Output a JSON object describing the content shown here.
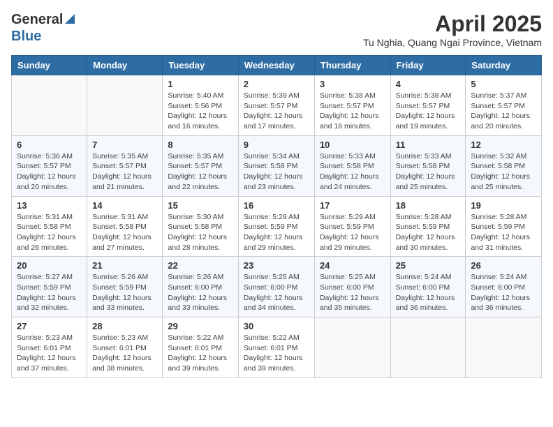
{
  "header": {
    "logo_general": "General",
    "logo_blue": "Blue",
    "month_title": "April 2025",
    "subtitle": "Tu Nghia, Quang Ngai Province, Vietnam"
  },
  "columns": [
    "Sunday",
    "Monday",
    "Tuesday",
    "Wednesday",
    "Thursday",
    "Friday",
    "Saturday"
  ],
  "weeks": [
    [
      {
        "day": "",
        "info": ""
      },
      {
        "day": "",
        "info": ""
      },
      {
        "day": "1",
        "info": "Sunrise: 5:40 AM\nSunset: 5:56 PM\nDaylight: 12 hours and 16 minutes."
      },
      {
        "day": "2",
        "info": "Sunrise: 5:39 AM\nSunset: 5:57 PM\nDaylight: 12 hours and 17 minutes."
      },
      {
        "day": "3",
        "info": "Sunrise: 5:38 AM\nSunset: 5:57 PM\nDaylight: 12 hours and 18 minutes."
      },
      {
        "day": "4",
        "info": "Sunrise: 5:38 AM\nSunset: 5:57 PM\nDaylight: 12 hours and 19 minutes."
      },
      {
        "day": "5",
        "info": "Sunrise: 5:37 AM\nSunset: 5:57 PM\nDaylight: 12 hours and 20 minutes."
      }
    ],
    [
      {
        "day": "6",
        "info": "Sunrise: 5:36 AM\nSunset: 5:57 PM\nDaylight: 12 hours and 20 minutes."
      },
      {
        "day": "7",
        "info": "Sunrise: 5:35 AM\nSunset: 5:57 PM\nDaylight: 12 hours and 21 minutes."
      },
      {
        "day": "8",
        "info": "Sunrise: 5:35 AM\nSunset: 5:57 PM\nDaylight: 12 hours and 22 minutes."
      },
      {
        "day": "9",
        "info": "Sunrise: 5:34 AM\nSunset: 5:58 PM\nDaylight: 12 hours and 23 minutes."
      },
      {
        "day": "10",
        "info": "Sunrise: 5:33 AM\nSunset: 5:58 PM\nDaylight: 12 hours and 24 minutes."
      },
      {
        "day": "11",
        "info": "Sunrise: 5:33 AM\nSunset: 5:58 PM\nDaylight: 12 hours and 25 minutes."
      },
      {
        "day": "12",
        "info": "Sunrise: 5:32 AM\nSunset: 5:58 PM\nDaylight: 12 hours and 25 minutes."
      }
    ],
    [
      {
        "day": "13",
        "info": "Sunrise: 5:31 AM\nSunset: 5:58 PM\nDaylight: 12 hours and 26 minutes."
      },
      {
        "day": "14",
        "info": "Sunrise: 5:31 AM\nSunset: 5:58 PM\nDaylight: 12 hours and 27 minutes."
      },
      {
        "day": "15",
        "info": "Sunrise: 5:30 AM\nSunset: 5:58 PM\nDaylight: 12 hours and 28 minutes."
      },
      {
        "day": "16",
        "info": "Sunrise: 5:29 AM\nSunset: 5:59 PM\nDaylight: 12 hours and 29 minutes."
      },
      {
        "day": "17",
        "info": "Sunrise: 5:29 AM\nSunset: 5:59 PM\nDaylight: 12 hours and 29 minutes."
      },
      {
        "day": "18",
        "info": "Sunrise: 5:28 AM\nSunset: 5:59 PM\nDaylight: 12 hours and 30 minutes."
      },
      {
        "day": "19",
        "info": "Sunrise: 5:28 AM\nSunset: 5:59 PM\nDaylight: 12 hours and 31 minutes."
      }
    ],
    [
      {
        "day": "20",
        "info": "Sunrise: 5:27 AM\nSunset: 5:59 PM\nDaylight: 12 hours and 32 minutes."
      },
      {
        "day": "21",
        "info": "Sunrise: 5:26 AM\nSunset: 5:59 PM\nDaylight: 12 hours and 33 minutes."
      },
      {
        "day": "22",
        "info": "Sunrise: 5:26 AM\nSunset: 6:00 PM\nDaylight: 12 hours and 33 minutes."
      },
      {
        "day": "23",
        "info": "Sunrise: 5:25 AM\nSunset: 6:00 PM\nDaylight: 12 hours and 34 minutes."
      },
      {
        "day": "24",
        "info": "Sunrise: 5:25 AM\nSunset: 6:00 PM\nDaylight: 12 hours and 35 minutes."
      },
      {
        "day": "25",
        "info": "Sunrise: 5:24 AM\nSunset: 6:00 PM\nDaylight: 12 hours and 36 minutes."
      },
      {
        "day": "26",
        "info": "Sunrise: 5:24 AM\nSunset: 6:00 PM\nDaylight: 12 hours and 36 minutes."
      }
    ],
    [
      {
        "day": "27",
        "info": "Sunrise: 5:23 AM\nSunset: 6:01 PM\nDaylight: 12 hours and 37 minutes."
      },
      {
        "day": "28",
        "info": "Sunrise: 5:23 AM\nSunset: 6:01 PM\nDaylight: 12 hours and 38 minutes."
      },
      {
        "day": "29",
        "info": "Sunrise: 5:22 AM\nSunset: 6:01 PM\nDaylight: 12 hours and 39 minutes."
      },
      {
        "day": "30",
        "info": "Sunrise: 5:22 AM\nSunset: 6:01 PM\nDaylight: 12 hours and 39 minutes."
      },
      {
        "day": "",
        "info": ""
      },
      {
        "day": "",
        "info": ""
      },
      {
        "day": "",
        "info": ""
      }
    ]
  ]
}
